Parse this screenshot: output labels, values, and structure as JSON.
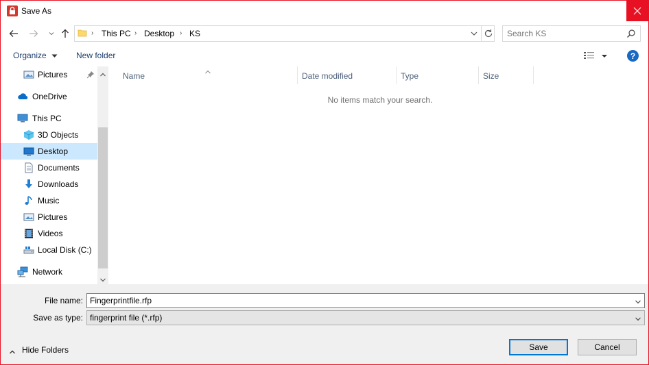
{
  "window": {
    "title": "Save As",
    "accent": "#e81123"
  },
  "address": {
    "crumbs": [
      "This PC",
      "Desktop",
      "KS"
    ]
  },
  "search": {
    "placeholder": "Search KS"
  },
  "toolbar": {
    "organize_label": "Organize",
    "new_folder_label": "New folder",
    "help_label": "?"
  },
  "nav": {
    "items": [
      {
        "label": "Pictures",
        "icon": "pictures-icon",
        "pinned": true
      },
      {
        "label": "OneDrive",
        "icon": "onedrive-icon"
      },
      {
        "label": "This PC",
        "icon": "this-pc-icon"
      },
      {
        "label": "3D Objects",
        "icon": "3d-objects-icon"
      },
      {
        "label": "Desktop",
        "icon": "desktop-icon",
        "selected": true
      },
      {
        "label": "Documents",
        "icon": "documents-icon"
      },
      {
        "label": "Downloads",
        "icon": "downloads-icon"
      },
      {
        "label": "Music",
        "icon": "music-icon"
      },
      {
        "label": "Pictures",
        "icon": "pictures-icon"
      },
      {
        "label": "Videos",
        "icon": "videos-icon"
      },
      {
        "label": "Local Disk (C:)",
        "icon": "local-disk-icon"
      },
      {
        "label": "Network",
        "icon": "network-icon"
      }
    ]
  },
  "filelist": {
    "columns": [
      "Name",
      "Date modified",
      "Type",
      "Size"
    ],
    "empty_message": "No items match your search."
  },
  "form": {
    "file_name_label": "File name:",
    "file_name_value": "Fingerprintfile.rfp",
    "save_type_label": "Save as type:",
    "save_type_value": "fingerprint file (*.rfp)"
  },
  "footer": {
    "hide_folders_label": "Hide Folders",
    "save_label": "Save",
    "cancel_label": "Cancel"
  }
}
